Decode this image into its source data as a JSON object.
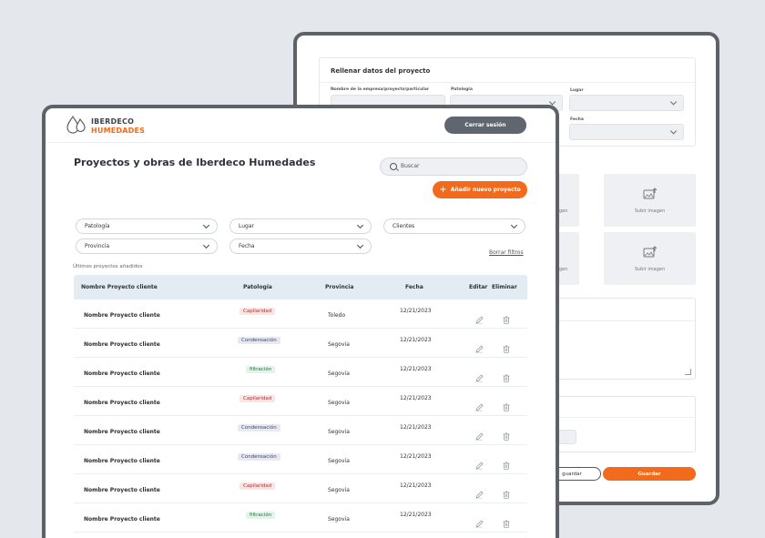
{
  "back_form": {
    "title": "Rellenar datos  del proyecto",
    "field_company_label": "Nombre de la empresa/proyecto/particular",
    "field_pathology_label": "Patología",
    "field_place_label": "Lugar",
    "field_date_label": "Fecha",
    "upload_label_1": "Subir imagen",
    "upload_label_2": "Subir imagen",
    "upload_partial_1": "gen",
    "upload_partial_2": "gen",
    "save_draft_label": "guardar",
    "save_label": "Guardar"
  },
  "header": {
    "logo_line1": "IBERDECO",
    "logo_line2": "HUMEDADES",
    "logout_label": "Cerrar sesión"
  },
  "main": {
    "title": "Proyectos y obras de Iberdeco Humedades",
    "search_placeholder": "Buscar",
    "add_label": "Añadir nuevo proyecto",
    "filters": {
      "pathology": "Patología",
      "place": "Lugar",
      "clients": "Clientes",
      "province": "Provincia",
      "date": "Fecha"
    },
    "clear_filters": "Borrar filtros",
    "recent_label": "Últimos proyectos añadidos"
  },
  "table": {
    "headers": {
      "name": "Nombre Proyecto cliente",
      "pathology": "Patología",
      "province": "Provincia",
      "date": "Fecha",
      "edit": "Editar",
      "delete": "Eliminar"
    },
    "rows": [
      {
        "name": "Nombre Proyecto cliente",
        "pathology": "Capilaridad",
        "tone": "red",
        "province": "Toledo",
        "date": "12/21/2023"
      },
      {
        "name": "Nombre Proyecto cliente",
        "pathology": "Condensación",
        "tone": "blue",
        "province": "Segovia",
        "date": "12/21/2023"
      },
      {
        "name": "Nombre Proyecto cliente",
        "pathology": "filtración",
        "tone": "green",
        "province": "Segovia",
        "date": "12/21/2023"
      },
      {
        "name": "Nombre Proyecto cliente",
        "pathology": "Capilaridad",
        "tone": "red",
        "province": "Segovia",
        "date": "12/21/2023"
      },
      {
        "name": "Nombre Proyecto cliente",
        "pathology": "Condensación",
        "tone": "blue",
        "province": "Segovia",
        "date": "12/21/2023"
      },
      {
        "name": "Nombre Proyecto cliente",
        "pathology": "Condensación",
        "tone": "blue",
        "province": "Segovia",
        "date": "12/21/2023"
      },
      {
        "name": "Nombre Proyecto cliente",
        "pathology": "Capilaridad",
        "tone": "red",
        "province": "Segovia",
        "date": "12/21/2023"
      },
      {
        "name": "Nombre Proyecto cliente",
        "pathology": "filtración",
        "tone": "green",
        "province": "Segovia",
        "date": "12/21/2023"
      }
    ]
  },
  "colors": {
    "accent": "#f26a1b",
    "dark_button": "#5f6670",
    "table_header_bg": "#e3ebf3"
  }
}
